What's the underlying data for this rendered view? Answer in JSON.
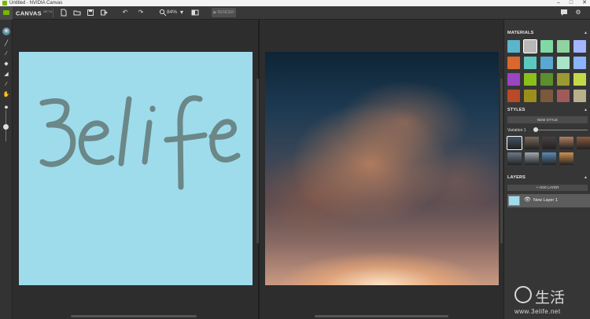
{
  "window": {
    "title": "Untitled - NVIDIA Canvas",
    "controls": [
      "–",
      "□",
      "✕"
    ]
  },
  "toolbar": {
    "brand": "CANVAS",
    "brand_badge": "BETA",
    "zoom_value": "84%",
    "zoom_icon": "magnifier-icon",
    "render_label": "RENDER"
  },
  "left_tools": [
    "cursor-icon",
    "brush-icon",
    "line-icon",
    "eraser-icon",
    "fill-icon",
    "eyedropper-icon",
    "pan-hand-icon"
  ],
  "paint_canvas": {
    "text": "3elife",
    "bg": "#9edcec",
    "stroke": "#6b8787"
  },
  "right_panel": {
    "materials": {
      "title": "MATERIALS",
      "swatches": [
        "#5bb6c9",
        "#b8b8b8",
        "#7fd9a4",
        "#8fd3a0",
        "#a4b4ff",
        "#d9682e",
        "#5cc9c0",
        "#5aa7d1",
        "#a9e3c8",
        "#8ab4ff",
        "#9a45c2",
        "#8bbf1a",
        "#5c8f2b",
        "#9a9a30",
        "#c3d94a",
        "#b84a2a",
        "#9c8e1c",
        "#7a5a3a",
        "#a05a5a",
        "#b8b08a"
      ],
      "selected_index": 1
    },
    "styles": {
      "title": "STYLES",
      "new_style_label": "NEW STYLE",
      "variation_label": "Variation 1",
      "variation_value": 0,
      "thumbs": [
        "#445566",
        "#7a6a5a",
        "#4a4040",
        "#b08060",
        "#8a5a40",
        "#6a7a8a",
        "#a0a8b0",
        "#5a8ab8",
        "#d09050"
      ],
      "selected_index": 0
    },
    "layers": {
      "title": "LAYERS",
      "add_label": "+ ADD LAYER",
      "items": [
        {
          "name": "New Layer 1"
        }
      ]
    }
  },
  "watermark": {
    "cn": "生活",
    "url": "www.3elife.net"
  }
}
